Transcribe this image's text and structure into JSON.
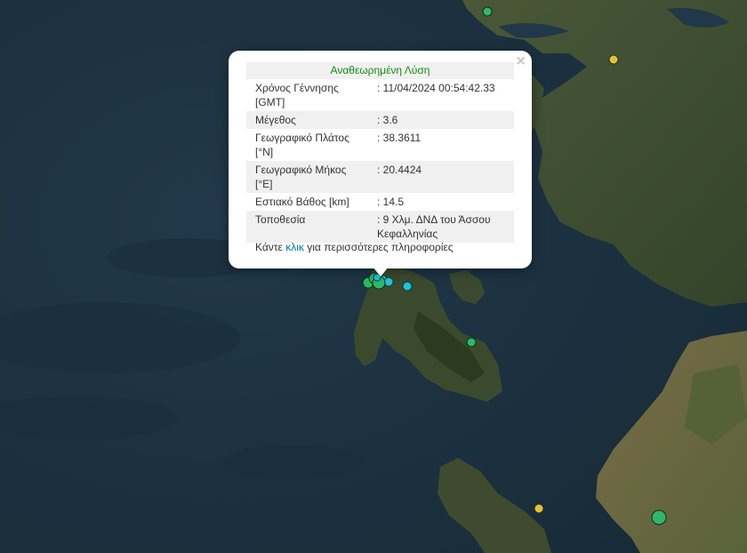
{
  "popup": {
    "title": "Αναθεωρημένη Λύση",
    "close_symbol": "×",
    "rows": [
      {
        "label": "Χρόνος Γέννησης [GMT]",
        "value": ": 11/04/2024 00:54:42.33"
      },
      {
        "label": "Μέγεθος",
        "value": ": 3.6"
      },
      {
        "label": "Γεωγραφικό Πλάτος [°N]",
        "value": ": 38.3611"
      },
      {
        "label": "Γεωγραφικό Μήκος [°E]",
        "value": ": 20.4424"
      },
      {
        "label": "Εστιακό Βάθος [km]",
        "value": ": 14.5"
      },
      {
        "label": "Τοποθεσία",
        "value": ": 9 Χλμ. ΔΝΔ του Άσσου Κεφαλληνίας"
      }
    ],
    "more_prefix": "Κάντε",
    "more_link": "κλικ",
    "more_suffix": "για περισσότερες πληροφορίες"
  },
  "colors": {
    "sea": "#1c3140",
    "land": "#3e4c30",
    "land_dark": "#2e3c25",
    "marker_cyan": "#22c4d4",
    "marker_green": "#2db86a",
    "marker_yellow": "#e0c23a",
    "title_green": "#158a15",
    "link_blue": "#0078a8"
  },
  "icons": {
    "close": "close-icon",
    "marker": "earthquake-marker-icon"
  }
}
